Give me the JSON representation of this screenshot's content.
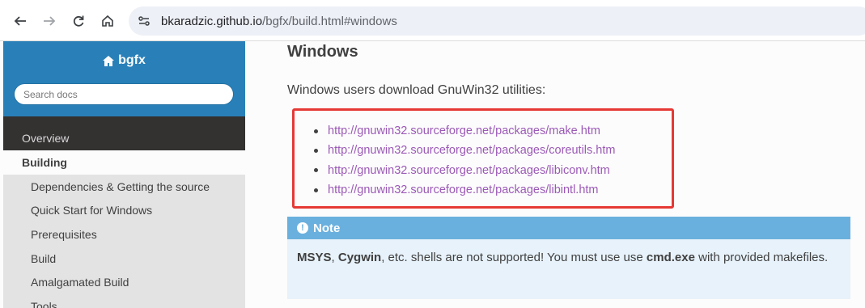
{
  "browser": {
    "url_host": "bkaradzic.github.io",
    "url_path": "/bgfx/build.html#windows",
    "icons": [
      "back-arrow-icon",
      "forward-arrow-icon",
      "reload-icon",
      "home-icon",
      "site-info-icon"
    ]
  },
  "sidebar": {
    "brand": "bgfx",
    "search_placeholder": "Search docs",
    "overview": "Overview",
    "current": "Building",
    "subitems": [
      "Dependencies & Getting the source",
      "Quick Start for Windows",
      "Prerequisites",
      "Build",
      "Amalgamated Build",
      "Tools"
    ],
    "colors": {
      "header": "#2980b9",
      "nav_bg": "#343131",
      "sub_bg": "#e3e3e3"
    }
  },
  "content": {
    "heading": "Windows",
    "intro": "Windows users download GnuWin32 utilities:",
    "links": [
      "http://gnuwin32.sourceforge.net/packages/make.htm",
      "http://gnuwin32.sourceforge.net/packages/coreutils.htm",
      "http://gnuwin32.sourceforge.net/packages/libiconv.htm",
      "http://gnuwin32.sourceforge.net/packages/libintl.htm"
    ],
    "highlight_color": "#e53935",
    "note": {
      "title": "Note",
      "b1": "MSYS",
      "t1": ", ",
      "b2": "Cygwin",
      "t2": ", etc. shells are not supported! You must use use ",
      "b3": "cmd.exe",
      "t3": " with provided makefiles."
    }
  }
}
